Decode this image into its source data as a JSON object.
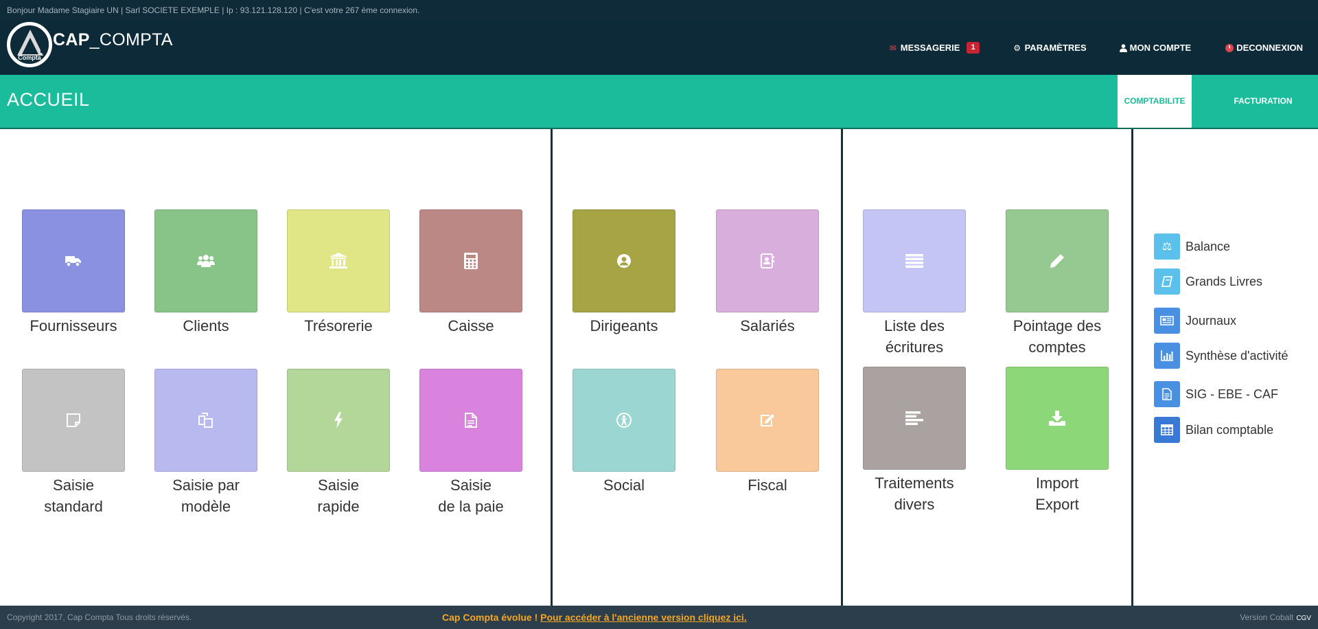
{
  "infobar": {
    "greeting": "Bonjour Madame Stagiaire UN",
    "company": "Sarl SOCIETE EXEMPLE",
    "ip": "Ip : 93.121.128.120",
    "connexion": "C'est votre 267 ème connexion."
  },
  "header": {
    "logo_text": "Compta",
    "brand_bold": "CAP",
    "brand_light": "_COMPTA",
    "nav": {
      "messagerie": "MESSAGERIE",
      "messagerie_count": "1",
      "parametres": "PARAMÈTRES",
      "mon_compte": "MON COMPTE",
      "deconnexion": "DECONNEXION"
    }
  },
  "band": {
    "title": "ACCUEIL",
    "tab_active": "COMPTABILITE",
    "tab_other": "FACTURATION"
  },
  "tiles": {
    "fournisseurs": {
      "line1": "Fournisseurs",
      "line2": "",
      "color": "#8a91e0",
      "icon": "truck-icon"
    },
    "clients": {
      "line1": "Clients",
      "line2": "",
      "color": "#88c488",
      "icon": "users-icon"
    },
    "tresorerie": {
      "line1": "Trésorerie",
      "line2": "",
      "color": "#e0e585",
      "icon": "bank-icon"
    },
    "caisse": {
      "line1": "Caisse",
      "line2": "",
      "color": "#bc8885",
      "icon": "calculator-icon"
    },
    "saisie_standard": {
      "line1": "Saisie",
      "line2": "standard",
      "color": "#c3c3c3",
      "icon": "sticky-note-icon"
    },
    "saisie_modele": {
      "line1": "Saisie par",
      "line2": "modèle",
      "color": "#b8b9ef",
      "icon": "copy-icon"
    },
    "saisie_rapide": {
      "line1": "Saisie",
      "line2": "rapide",
      "color": "#b2d798",
      "icon": "bolt-icon"
    },
    "saisie_paie": {
      "line1": "Saisie",
      "line2": "de la paie",
      "color": "#da83de",
      "icon": "file-text-icon"
    },
    "dirigeants": {
      "line1": "Dirigeants",
      "line2": "",
      "color": "#a6a445",
      "icon": "user-circle-icon"
    },
    "salaries": {
      "line1": "Salariés",
      "line2": "",
      "color": "#d8afdc",
      "icon": "address-book-icon"
    },
    "social": {
      "line1": "Social",
      "line2": "",
      "color": "#9cd6d2",
      "icon": "universal-access-icon"
    },
    "fiscal": {
      "line1": "Fiscal",
      "line2": "",
      "color": "#f9c89b",
      "icon": "edit-icon"
    },
    "liste_ecritures": {
      "line1": "Liste des",
      "line2": "écritures",
      "color": "#c4c5f5",
      "icon": "list-icon"
    },
    "pointage": {
      "line1": "Pointage des",
      "line2": "comptes",
      "color": "#96c891",
      "icon": "pencil-icon"
    },
    "traitements": {
      "line1": "Traitements",
      "line2": "divers",
      "color": "#aaa1a1",
      "icon": "align-left-icon"
    },
    "import_export": {
      "line1": "Import",
      "line2": "Export",
      "color": "#8cd778",
      "icon": "download-icon"
    }
  },
  "sidebar": {
    "items": [
      {
        "label": "Balance",
        "color": "#5bc0eb",
        "icon": "scale-icon"
      },
      {
        "label": "Grands Livres",
        "color": "#5bc0eb",
        "icon": "book-icon"
      },
      {
        "label": "Journaux",
        "color": "#4a90e2",
        "icon": "newspaper-icon"
      },
      {
        "label": "Synthèse d'activité",
        "color": "#4a90e2",
        "icon": "bar-chart-icon"
      },
      {
        "label": "SIG - EBE - CAF",
        "color": "#4a90e2",
        "icon": "file-icon"
      },
      {
        "label": "Bilan comptable",
        "color": "#3a78d6",
        "icon": "table-icon"
      }
    ]
  },
  "footer": {
    "copyright": "Copyright 2017, Cap Compta Tous droits réservés.",
    "notice": "Cap Compta évolue !",
    "link": "Pour accéder à l'ancienne version cliquez ici.",
    "version": "Version Cobalt",
    "cgv": "CGV"
  }
}
